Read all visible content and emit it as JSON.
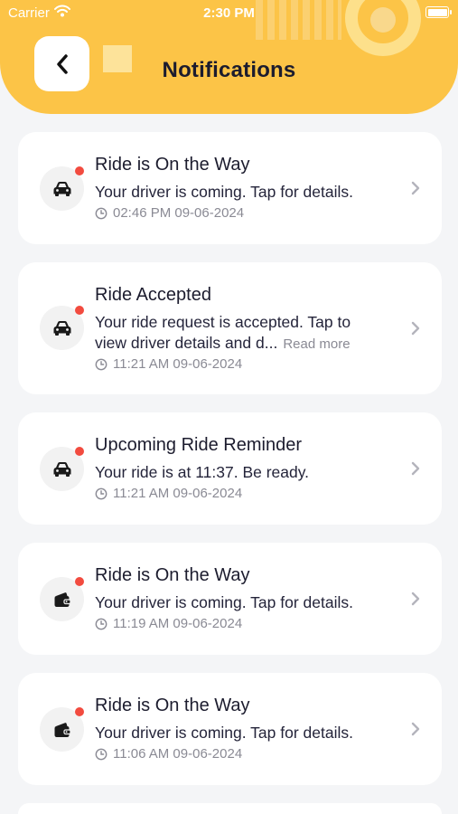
{
  "status_bar": {
    "carrier": "Carrier",
    "time": "2:30 PM"
  },
  "header": {
    "title": "Notifications"
  },
  "notifications": [
    {
      "title": "Ride is On the Way",
      "body_line1": "Your driver is coming. Tap for details.",
      "body_line2": "",
      "read_more": "",
      "time": "02:46 PM 09-06-2024",
      "icon": "car-icon",
      "unread": true
    },
    {
      "title": "Ride Accepted",
      "body_line1": "Your ride request is accepted. Tap to",
      "body_line2": "view driver details and d...",
      "read_more": "Read more",
      "time": "11:21 AM 09-06-2024",
      "icon": "car-icon",
      "unread": true
    },
    {
      "title": "Upcoming Ride Reminder",
      "body_line1": "Your ride is at 11:37. Be ready.",
      "body_line2": "",
      "read_more": "",
      "time": "11:21 AM 09-06-2024",
      "icon": "car-icon",
      "unread": true
    },
    {
      "title": "Ride is On the Way",
      "body_line1": "Your driver is coming. Tap for details.",
      "body_line2": "",
      "read_more": "",
      "time": "11:19 AM 09-06-2024",
      "icon": "wallet-icon",
      "unread": true
    },
    {
      "title": "Ride is On the Way",
      "body_line1": "Your driver is coming. Tap for details.",
      "body_line2": "",
      "read_more": "",
      "time": "11:06 AM 09-06-2024",
      "icon": "wallet-icon",
      "unread": true
    }
  ],
  "colors": {
    "header": "#fcc447",
    "unread_dot": "#f24b3f",
    "background": "#f4f5f7"
  }
}
